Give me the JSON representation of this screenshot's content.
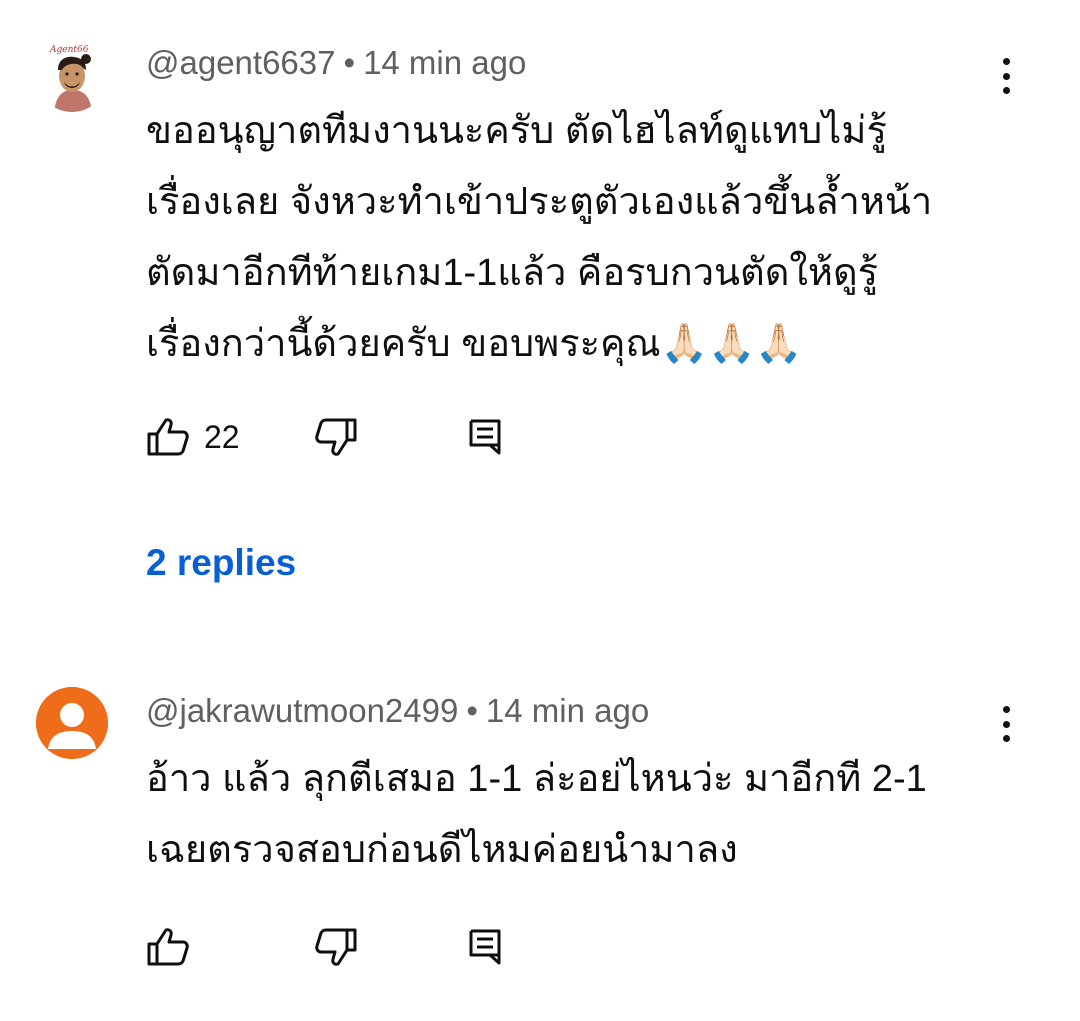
{
  "comments": [
    {
      "handle": "@agent6637",
      "separator": "•",
      "time": "14 min ago",
      "text": "ขออนุญาตทีมงานนะครับ ตัดไฮไลท์ดูแทบไม่รู้\nเรื่องเลย จังหวะทำเข้าประตูตัวเองแล้วขึ้นล้ำหน้า\nตัดมาอีกทีท้ายเกม1-1แล้ว คือรบกวนตัดให้ดูรู้\nเรื่องกว่านี้ด้วยครับ ขอบพระคุณ🙏🏻🙏🏻🙏🏻",
      "likes": "22",
      "replies_label": "2 replies",
      "avatar_icon": "cartoon-man-avatar"
    },
    {
      "handle": "@jakrawutmoon2499",
      "separator": "•",
      "time": "14 min ago",
      "text": "อ้าว แล้ว ลุกตีเสมอ 1-1 ล่ะอย่ไหนว่ะ มาอีกที 2-1\nเฉยตรวจสอบก่อนดีไหมค่อยนำมาลง",
      "avatar_icon": "default-user-avatar",
      "avatar_color": "#ef6c1a"
    }
  ],
  "colors": {
    "link": "#065fd4",
    "meta": "#606060",
    "text": "#0f0f0f"
  }
}
